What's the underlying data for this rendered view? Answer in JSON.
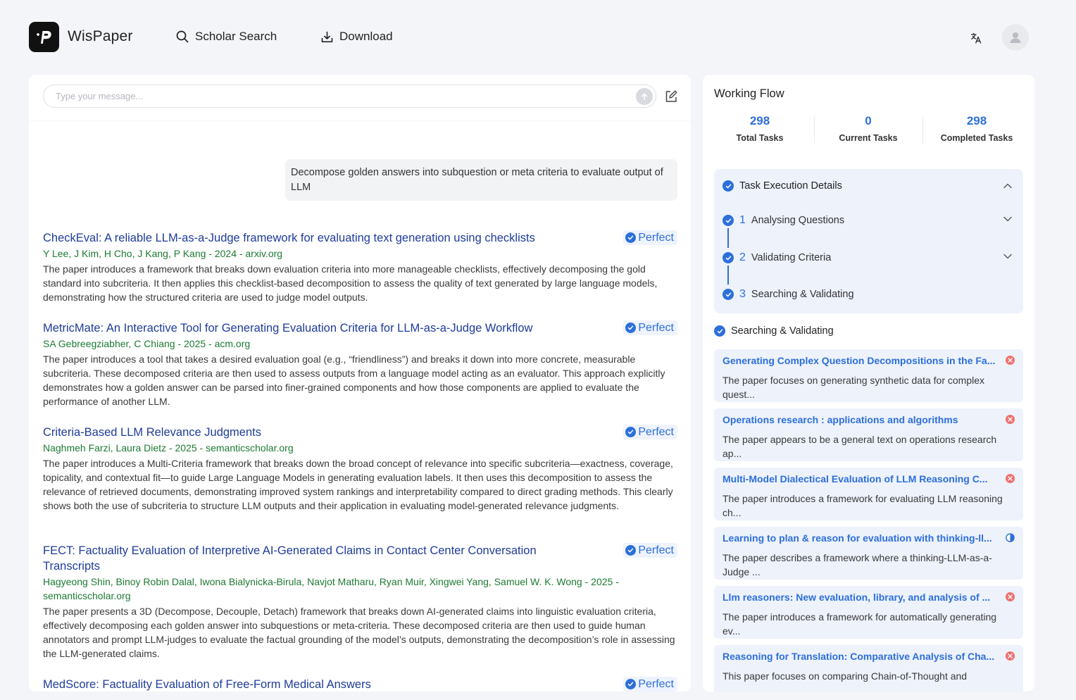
{
  "header": {
    "brand": "WisPaper",
    "nav": [
      {
        "label": "Scholar Search",
        "icon": "search-icon"
      },
      {
        "label": "Download",
        "icon": "download-icon"
      }
    ],
    "translate_icon": "translate-icon",
    "avatar_icon": "user-avatar-icon"
  },
  "chat": {
    "placeholder": "Type your message...",
    "user_message": "Decompose golden answers into subquestion or meta criteria to evaluate output of LLM"
  },
  "results": [
    {
      "title": "CheckEval: A reliable LLM-as-a-Judge framework for evaluating text generation using checklists",
      "badge": "Perfect",
      "meta": "Y Lee, J Kim, H Cho, J Kang, P Kang - 2024 - arxiv.org",
      "desc": "The paper introduces a framework that breaks down evaluation criteria into more manageable checklists, effectively decomposing the gold standard into subcriteria. It then applies this checklist-based decomposition to assess the quality of text generated by large language models, demonstrating how the structured criteria are used to judge model outputs."
    },
    {
      "title": "MetricMate: An Interactive Tool for Generating Evaluation Criteria for LLM-as-a-Judge Workflow",
      "badge": "Perfect",
      "meta": "SA Gebreegziabher, C Chiang - 2025 - acm.org",
      "desc": "The paper introduces a tool that takes a desired evaluation goal (e.g., “friendliness”) and breaks it down into more concrete, measurable subcriteria. These decomposed criteria are then used to assess outputs from a language model acting as an evaluator. This approach explicitly demonstrates how a golden answer can be parsed into finer-grained components and how those components are applied to evaluate the performance of another LLM."
    },
    {
      "title": "Criteria-Based LLM Relevance Judgments",
      "badge": "Perfect",
      "meta": "Naghmeh Farzi, Laura Dietz - 2025 - semanticscholar.org",
      "desc": "The paper introduces a Multi-Criteria framework that breaks down the broad concept of relevance into specific subcriteria—exactness, coverage, topicality, and contextual fit—to guide Large Language Models in generating evaluation labels. It then uses this decomposition to assess the relevance of retrieved documents, demonstrating improved system rankings and interpretability compared to direct grading methods. This clearly shows both the use of subcriteria to structure LLM outputs and their application in evaluating model-generated relevance judgments."
    },
    {
      "title": "FECT: Factuality Evaluation of Interpretive AI-Generated Claims in Contact Center Conversation Transcripts",
      "badge": "Perfect",
      "meta": "Hagyeong Shin, Binoy Robin Dalal, Iwona Bialynicka-Birula, Navjot Matharu, Ryan Muir, Xingwei Yang, Samuel W. K. Wong - 2025 - semanticscholar.org",
      "desc": "The paper presents a 3D (Decompose, Decouple, Detach) framework that breaks down AI-generated claims into linguistic evaluation criteria, effectively decomposing each golden answer into subquestions or meta-criteria. These decomposed criteria are then used to guide human annotators and prompt LLM-judges to evaluate the factual grounding of the model’s outputs, demonstrating the decomposition’s role in assessing the LLM-generated claims."
    },
    {
      "title": "MedScore: Factuality Evaluation of Free-Form Medical Answers",
      "badge": "Perfect",
      "meta": "",
      "desc": ""
    }
  ],
  "workflow": {
    "title": "Working Flow",
    "stats": [
      {
        "value": "298",
        "label": "Total Tasks"
      },
      {
        "value": "0",
        "label": "Current Tasks"
      },
      {
        "value": "298",
        "label": "Completed Tasks"
      }
    ],
    "exec_title": "Task Execution Details",
    "steps": [
      {
        "num": "1",
        "label": "Analysing Questions"
      },
      {
        "num": "2",
        "label": "Validating Criteria"
      },
      {
        "num": "3",
        "label": "Searching & Validating"
      }
    ],
    "sv_title": "Searching & Validating",
    "cards": [
      {
        "title": "Generating Complex Question Decompositions in the Fa...",
        "desc": "The paper focuses on generating synthetic data for complex quest...",
        "status": "rejected"
      },
      {
        "title": "Operations research : applications and algorithms",
        "desc": "The paper appears to be a general text on operations research ap...",
        "status": "rejected"
      },
      {
        "title": "Multi-Model Dialectical Evaluation of LLM Reasoning C...",
        "desc": "The paper introduces a framework for evaluating LLM reasoning ch...",
        "status": "rejected"
      },
      {
        "title": "Learning to plan & reason for evaluation with thinking-ll...",
        "desc": "The paper describes a framework where a thinking-LLM-as-a-Judge ...",
        "status": "partial"
      },
      {
        "title": "Llm reasoners: New evaluation, library, and analysis of ...",
        "desc": "The paper introduces a framework for automatically generating ev...",
        "status": "rejected"
      },
      {
        "title": "Reasoning for Translation: Comparative Analysis of Cha...",
        "desc": "This paper focuses on comparing Chain-of-Thought and",
        "status": "rejected"
      }
    ]
  },
  "colors": {
    "accent": "#2d6fd9",
    "title_link": "#1f3c9a",
    "meta_green": "#1d7a34",
    "reject_red": "#ef6f6c",
    "panel_bg": "#edf2fb"
  }
}
